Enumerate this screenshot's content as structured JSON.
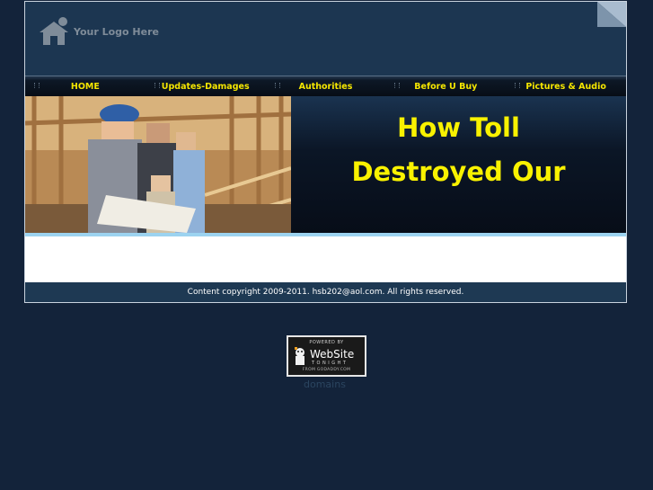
{
  "header": {
    "logo_text": "Your Logo Here",
    "logo_icon": "house-person-icon"
  },
  "nav": {
    "items": [
      {
        "label": "HOME"
      },
      {
        "label": "Updates-Damages"
      },
      {
        "label": "Authorities"
      },
      {
        "label": "Before U Buy"
      },
      {
        "label": "Pictures & Audio"
      }
    ]
  },
  "banner": {
    "headline_line1": "How Toll",
    "headline_line2": "Destroyed Our"
  },
  "footer": {
    "copyright": "Content copyright 2009-2011. hsb202@aol.com. All rights reserved."
  },
  "badge": {
    "powered_by": "POWERED BY",
    "brand": "WebSite",
    "tonight": "TONIGHT",
    "from": "FROM GODADDY.COM"
  },
  "domains_link": "domains",
  "colors": {
    "page_bg": "#13233a",
    "header_bg": "#1c3651",
    "nav_text": "#f5e600",
    "headline": "#f9f200",
    "accent_strip": "#9cd3f0"
  }
}
